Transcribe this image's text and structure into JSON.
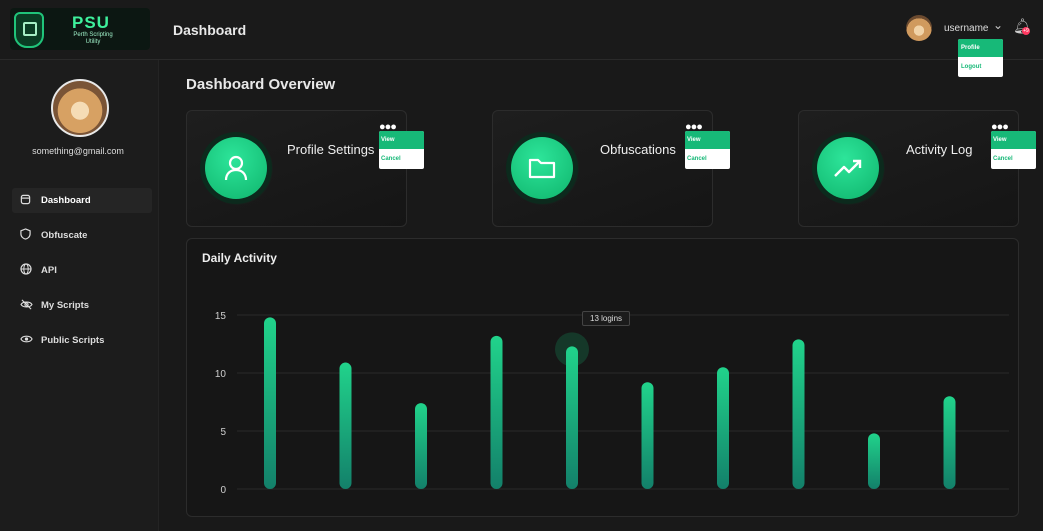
{
  "header": {
    "logo_text": "PSU",
    "logo_subtitle": "Perth Scripting Utility",
    "page_title": "Dashboard",
    "username": "username",
    "notification_count": "+9",
    "user_menu": [
      "Profile",
      "Logout"
    ]
  },
  "sidebar": {
    "email": "something@gmail.com",
    "items": [
      {
        "label": "Dashboard",
        "icon": "dashboard-icon"
      },
      {
        "label": "Obfuscate",
        "icon": "shield-icon"
      },
      {
        "label": "API",
        "icon": "globe-icon"
      },
      {
        "label": "My Scripts",
        "icon": "eye-off-icon"
      },
      {
        "label": "Public Scripts",
        "icon": "eye-icon"
      }
    ]
  },
  "main": {
    "heading": "Dashboard Overview",
    "cards": [
      {
        "title": "Profile Settings",
        "icon": "user-icon",
        "menu": [
          "View",
          "Cancel"
        ]
      },
      {
        "title": "Obfuscations",
        "icon": "folder-icon",
        "menu": [
          "View",
          "Cancel"
        ]
      },
      {
        "title": "Activity Log",
        "icon": "trending-up-icon",
        "menu": [
          "View",
          "Cancel"
        ]
      }
    ]
  },
  "chart_data": {
    "type": "bar",
    "title": "Daily Activity",
    "categories": [
      "",
      "",
      "",
      "",
      "",
      "",
      "",
      "",
      "",
      ""
    ],
    "values": [
      14.8,
      10.9,
      7.4,
      13.2,
      12.3,
      9.2,
      10.5,
      12.9,
      4.8,
      8.0
    ],
    "yticks": [
      0,
      5,
      10,
      15
    ],
    "ylim": [
      0,
      16
    ],
    "tooltip": "13 logins",
    "highlight_index": 4,
    "bar_color_top": "#21d38b",
    "bar_color_bottom": "#13806a"
  },
  "colors": {
    "accent": "#17b978",
    "background": "#191919"
  }
}
